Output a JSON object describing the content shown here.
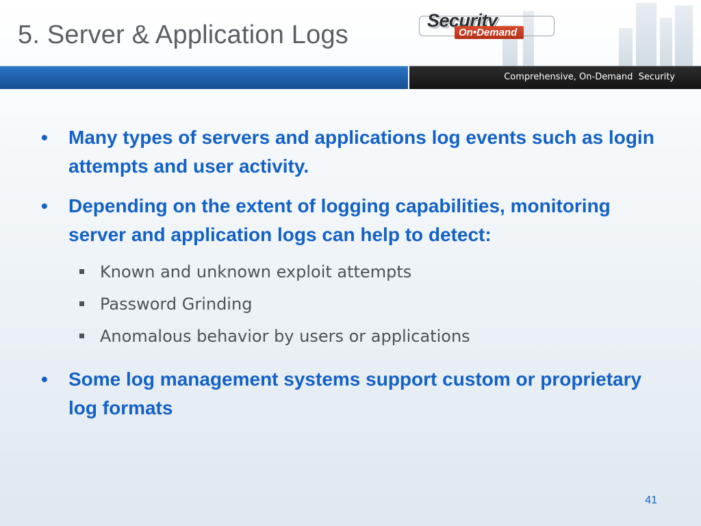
{
  "slide": {
    "title": "5. Server & Application Logs",
    "tagline": "Comprehensive, On-Demand  Security",
    "page_number": "41"
  },
  "logo": {
    "word1": "Security",
    "word2": "On•Demand"
  },
  "bullets": [
    {
      "text": "Many types of servers and applications log events such as login attempts and user activity."
    },
    {
      "text": "Depending on the extent of logging capabilities, monitoring server and application logs can help to detect:"
    },
    {
      "text": "Some log management systems support custom or proprietary log formats"
    }
  ],
  "sub_bullets": [
    {
      "text": "Known and unknown exploit attempts"
    },
    {
      "text": "Password Grinding"
    },
    {
      "text": "Anomalous behavior by users or applications"
    }
  ],
  "colors": {
    "title": "#5b5e62",
    "bullet_text": "#1461c6",
    "sub_bullet_text": "#4d5256",
    "header_bar_blue": "#1e5ea8",
    "header_bar_dark": "#1c1c1c"
  }
}
